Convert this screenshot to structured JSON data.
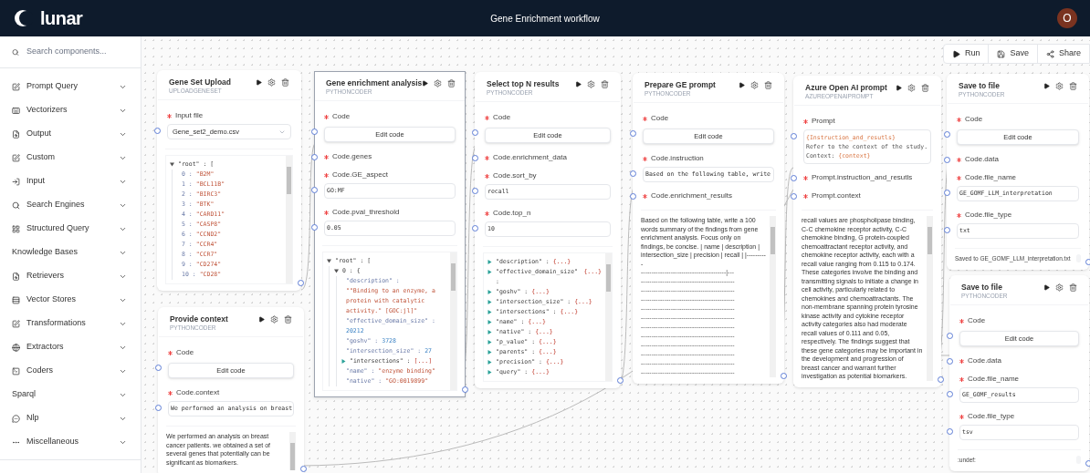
{
  "header": {
    "logo_text": "lunar",
    "title": "Gene Enrichment workflow",
    "avatar_initial": "O"
  },
  "sidebar": {
    "search": {
      "placeholder": "Search components..."
    },
    "items": [
      {
        "label": "Prompt Query",
        "expanded": false
      },
      {
        "label": "Vectorizers",
        "expanded": false
      },
      {
        "label": "Output",
        "expanded": false
      },
      {
        "label": "Custom",
        "expanded": false
      },
      {
        "label": "Input",
        "expanded": false
      },
      {
        "label": "Search Engines",
        "expanded": false
      },
      {
        "label": "Structured Query",
        "expanded": false
      },
      {
        "label": "Knowledge Bases",
        "expanded": false
      },
      {
        "label": "Retrievers",
        "expanded": false
      },
      {
        "label": "Vector Stores",
        "expanded": false
      },
      {
        "label": "Transformations",
        "expanded": false
      },
      {
        "label": "Extractors",
        "expanded": false
      },
      {
        "label": "Coders",
        "expanded": false
      },
      {
        "label": "Sparql",
        "expanded": false
      },
      {
        "label": "Nlp",
        "expanded": false
      },
      {
        "label": "Miscellaneous",
        "expanded": false
      }
    ]
  },
  "toolbar": [
    {
      "label": "Run"
    },
    {
      "label": "Save"
    },
    {
      "label": "Share"
    }
  ],
  "nodes": [
    {
      "title": "Gene Set Upload",
      "subtitle": "UPLOADGENESET",
      "selected": false,
      "fields": [
        {
          "label": "Input file",
          "kind": "select",
          "value": "Gene_set2_demo.csv"
        }
      ],
      "output": {
        "kind": "json",
        "tree": [
          {
            "key": "\"root\" :",
            "open": "[",
            "expanded": true,
            "children": [
              {
                "key": "0 :",
                "value": "\"B2M\"",
                "kind": "string"
              },
              {
                "key": "1 :",
                "value": "\"BCL11B\"",
                "kind": "string"
              },
              {
                "key": "2 :",
                "value": "\"BIRC3\"",
                "kind": "string"
              },
              {
                "key": "3 :",
                "value": "\"BTK\"",
                "kind": "string"
              },
              {
                "key": "4 :",
                "value": "\"CARD11\"",
                "kind": "string"
              },
              {
                "key": "5 :",
                "value": "\"CASP8\"",
                "kind": "string"
              },
              {
                "key": "6 :",
                "value": "\"CCND2\"",
                "kind": "string"
              },
              {
                "key": "7 :",
                "value": "\"CCR4\"",
                "kind": "string"
              },
              {
                "key": "8 :",
                "value": "\"CCR7\"",
                "kind": "string"
              },
              {
                "key": "9 :",
                "value": "\"CD274\"",
                "kind": "string"
              },
              {
                "key": "10 :",
                "value": "\"CD28\"",
                "kind": "string"
              }
            ]
          }
        ]
      }
    },
    {
      "title": "Provide context",
      "subtitle": "PYTHONCODER",
      "selected": false,
      "fields": [
        {
          "label": "Code",
          "kind": "button",
          "value": "Edit code"
        },
        {
          "label": "Code.context",
          "kind": "input",
          "value": "We performed an analysis on breast"
        }
      ],
      "output": {
        "kind": "text",
        "text": "We performed an analysis on breast cancer patients. we obtained a set of several genes that potentially can be significant as biomarkers."
      }
    },
    {
      "title": "Gene enrichment analysis",
      "subtitle": "PYTHONCODER",
      "selected": true,
      "fields": [
        {
          "label": "Code",
          "kind": "button",
          "value": "Edit code"
        },
        {
          "label": "Code.genes",
          "kind": "label"
        },
        {
          "label": "Code.GE_aspect",
          "kind": "input",
          "value": "GO:MF"
        },
        {
          "label": "Code.pval_threshold",
          "kind": "input",
          "value": "0.05"
        }
      ],
      "output": {
        "kind": "json",
        "tree": [
          {
            "key": "\"root\" :",
            "open": "[",
            "expanded": true,
            "children": [
              {
                "key": "0 :",
                "open": "{",
                "expanded": true,
                "children": [
                  {
                    "key": "\"description\" :",
                    "value": "\"\"Binding to an enzyme, a protein with catalytic activity.\" [GOC:jl]\"",
                    "kind": "string"
                  },
                  {
                    "key": "\"effective_domain_size\" :",
                    "value": "20212",
                    "kind": "number"
                  },
                  {
                    "key": "\"goshv\" :",
                    "value": "3728",
                    "kind": "number"
                  },
                  {
                    "key": "\"intersection_size\" :",
                    "value": "27",
                    "kind": "number"
                  },
                  {
                    "key": "\"intersections\" :",
                    "collapsed_text": "[...]",
                    "expanded": false
                  },
                  {
                    "key": "\"name\" :",
                    "value": "\"enzyme binding\"",
                    "kind": "string"
                  },
                  {
                    "key": "\"native\" :",
                    "value": "\"GO:0019899\"",
                    "kind": "string"
                  }
                ]
              }
            ]
          }
        ]
      }
    },
    {
      "title": "Select top N results",
      "subtitle": "PYTHONCODER",
      "selected": false,
      "fields": [
        {
          "label": "Code",
          "kind": "button",
          "value": "Edit code"
        },
        {
          "label": "Code.enrichment_data",
          "kind": "label"
        },
        {
          "label": "Code.sort_by",
          "kind": "input",
          "value": "recall"
        },
        {
          "label": "Code.top_n",
          "kind": "input",
          "value": "10"
        }
      ],
      "output": {
        "kind": "json",
        "tree": [
          {
            "key": "\"description\" :",
            "collapsed_text": "{...}",
            "expanded": false
          },
          {
            "key": "\"effective_domain_size\" :",
            "collapsed_text": "{...}",
            "expanded": false
          },
          {
            "key": "\"goshv\" :",
            "collapsed_text": "{...}",
            "expanded": false
          },
          {
            "key": "\"intersection_size\" :",
            "collapsed_text": "{...}",
            "expanded": false
          },
          {
            "key": "\"intersections\" :",
            "collapsed_text": "{...}",
            "expanded": false
          },
          {
            "key": "\"name\" :",
            "collapsed_text": "{...}",
            "expanded": false
          },
          {
            "key": "\"native\" :",
            "collapsed_text": "{...}",
            "expanded": false
          },
          {
            "key": "\"p_value\" :",
            "collapsed_text": "{...}",
            "expanded": false
          },
          {
            "key": "\"parents\" :",
            "collapsed_text": "{...}",
            "expanded": false
          },
          {
            "key": "\"precision\" :",
            "collapsed_text": "{...}",
            "expanded": false
          },
          {
            "key": "\"query\" :",
            "collapsed_text": "{...}",
            "expanded": false
          }
        ]
      }
    },
    {
      "title": "Prepare GE prompt",
      "subtitle": "PYTHONCODER",
      "selected": false,
      "fields": [
        {
          "label": "Code",
          "kind": "button",
          "value": "Edit code"
        },
        {
          "label": "Code.instruction",
          "kind": "input",
          "value": "Based on the following table, write"
        },
        {
          "label": "Code.enrichment_results",
          "kind": "label"
        }
      ],
      "output": {
        "kind": "text",
        "text": "Based on the following table, write a 100 words summary of the findings from gene enrichment analysis. Focus only on findings, be concise. | name | description | intersection_size | precision | recall | |----------",
        "rule_lines": [
          "----------------------------------------|---",
          "--------------------------------------------",
          "--------------------------------------------",
          "--------------------------------------------",
          "--------------------------------------------",
          "--------------------------------------------",
          "--------------------------------------------",
          "--------------------------------------------",
          "--------------------------------------------",
          "--------------------------------------------",
          "--------------------------------------------",
          "--------------------------------------------"
        ]
      }
    },
    {
      "title": "Azure Open AI prompt",
      "subtitle": "AZUREOPENAIPROMPT",
      "selected": false,
      "fields": [
        {
          "label": "Prompt",
          "kind": "textarea",
          "lines": [
            [
              {
                "text": "{Instruction_and_resutls}",
                "kind": "variable"
              }
            ],
            [
              {
                "text": "Refer to the context of the study.",
                "kind": "plain"
              }
            ],
            [
              {
                "text": "Context: ",
                "kind": "plain"
              },
              {
                "text": "{context}",
                "kind": "variable"
              }
            ]
          ]
        },
        {
          "label": "Prompt.instruction_and_resutls",
          "kind": "label"
        },
        {
          "label": "Prompt.context",
          "kind": "label"
        }
      ],
      "output": {
        "kind": "text",
        "text": "recall values are phospholipase binding, C-C chemokine receptor activity, C-C chemokine binding, G protein-coupled chemoattractant receptor activity, and chemokine receptor activity, each with a recall value ranging from 0.115 to 0.174. These categories involve the binding and transmitting signals to initiate a change in cell activity, particularly related to chemokines and chemoattractants. The non-membrane spanning protein tyrosine kinase activity and cytokine receptor activity categories also had moderate recall values of 0.111 and 0.05, respectively. The findings suggest that these gene categories may be important in the development and progression of breast cancer and warrant further investigation as potential biomarkers."
      }
    },
    {
      "title": "Save to file",
      "subtitle": "PYTHONCODER",
      "selected": false,
      "fields": [
        {
          "label": "Code",
          "kind": "button",
          "value": "Edit code"
        },
        {
          "label": "Code.data",
          "kind": "label"
        },
        {
          "label": "Code.file_name",
          "kind": "input",
          "value": "GE_GOMF_LLM_interpretation"
        },
        {
          "label": "Code.file_type",
          "kind": "input",
          "value": "txt"
        }
      ],
      "output": {
        "kind": "status",
        "text": "Saved to GE_GOMF_LLM_interpretation.txt"
      }
    },
    {
      "title": "Save to file",
      "subtitle": "PYTHONCODER",
      "selected": false,
      "fields": [
        {
          "label": "Code",
          "kind": "button",
          "value": "Edit code"
        },
        {
          "label": "Code.data",
          "kind": "label"
        },
        {
          "label": "Code.file_name",
          "kind": "input",
          "value": "GE_GOMF_results"
        },
        {
          "label": "Code.file_type",
          "kind": "input",
          "value": "tsv"
        }
      ],
      "output": {
        "kind": "status",
        "text": ":undef:"
      }
    }
  ]
}
